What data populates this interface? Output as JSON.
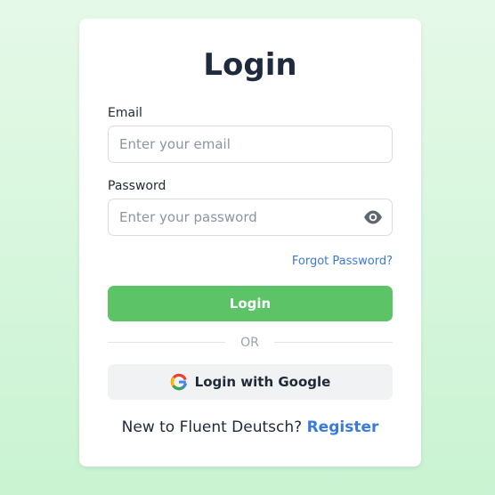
{
  "login_form": {
    "title": "Login",
    "email_label": "Email",
    "email_placeholder": "Enter your email",
    "email_value": "",
    "password_label": "Password",
    "password_placeholder": "Enter your password",
    "password_value": "",
    "forgot_password": "Forgot Password?",
    "login_button": "Login",
    "divider_text": "OR",
    "google_button": "Login with Google",
    "register_prompt": "New to Fluent Deutsch?",
    "register_link": "Register"
  },
  "icons": {
    "password_toggle": "eye-icon",
    "google": "google-logo-icon"
  },
  "colors": {
    "primary_green": "#5cc467",
    "link_blue": "#3b7ad9",
    "title_dark": "#1f2a3c",
    "background_green": "#d7f6dd"
  }
}
